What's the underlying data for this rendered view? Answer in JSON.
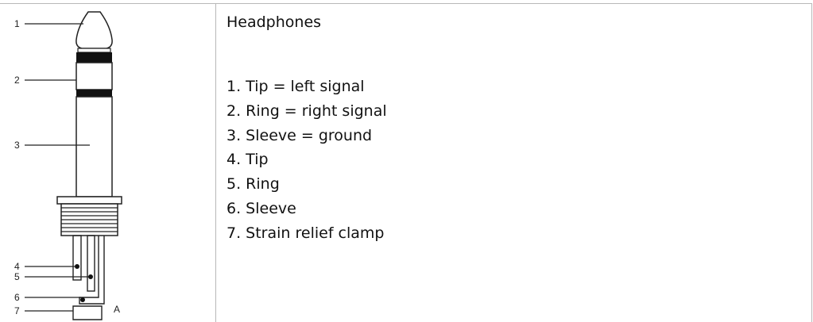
{
  "heading": "Headphones",
  "items": [
    "1. Tip = left signal",
    "2. Ring = right signal",
    "3. Sleeve = ground",
    "4. Tip",
    "5. Ring",
    "6. Sleeve",
    "7. Strain relief clamp"
  ],
  "figure": {
    "callouts": [
      "1",
      "2",
      "3",
      "4",
      "5",
      "6",
      "7"
    ],
    "corner_label": "A"
  }
}
